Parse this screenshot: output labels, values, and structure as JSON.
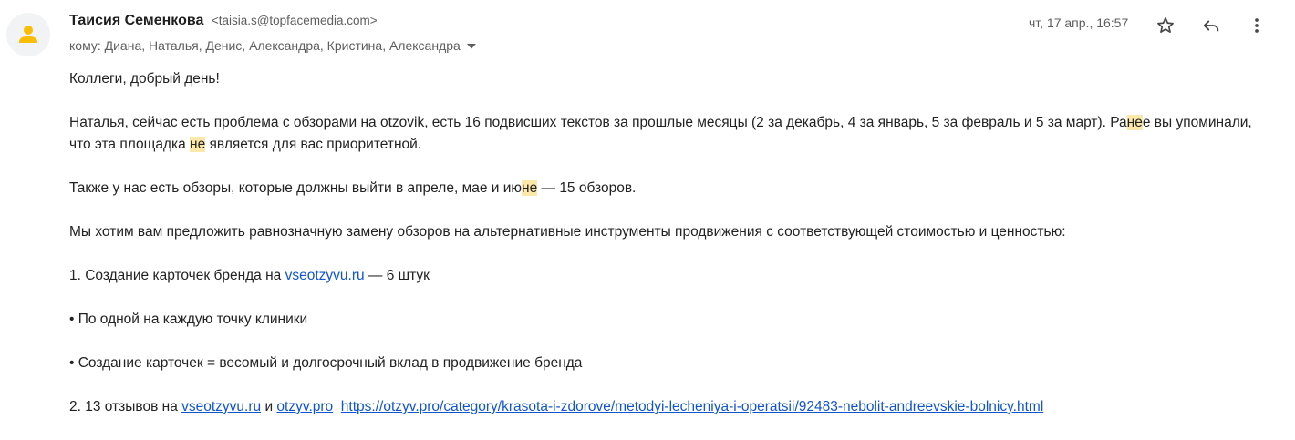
{
  "header": {
    "sender_name": "Таисия Семенкова",
    "sender_email": "<taisia.s@topfacemedia.com>",
    "recipients": "кому: Диана, Наталья, Денис, Александра, Кристина, Александра",
    "date": "чт, 17 апр., 16:57"
  },
  "icons": {
    "avatar": "person-avatar-icon",
    "recipients_toggle": "caret-down-icon",
    "star": "star-outline-icon",
    "reply": "reply-arrow-icon",
    "more": "vertical-dots-icon"
  },
  "colors": {
    "highlight": "#fce8a8",
    "link": "#1155cc"
  },
  "body": {
    "greeting": "Коллеги, добрый день!",
    "p2": {
      "a": "Наталья, сейчас есть проблема с обзорами на otzovik, есть 16 подвисших текстов за прошлые месяцы (2 за декабрь, 4 за январь, 5 за февраль и 5 за март). Ра",
      "hl1": "не",
      "b": "е вы упоминали, что эта площадка ",
      "hl2": "не",
      "c": " является для вас приоритетной."
    },
    "p3": {
      "a": "Также у нас есть обзоры, которые должны выйти в апреле, мае и ию",
      "hl": "не",
      "b": " — 15 обзоров."
    },
    "p4": "Мы хотим вам предложить равнозначную замену обзоров на альтернативные инструменты продвижения с соответствующей стоимостью и ценностью:",
    "p5": {
      "a": "1. Создание карточек бренда на ",
      "link": "vseotzyvu.ru",
      "b": " — 6 штук"
    },
    "p6": "• По одной на каждую точку клиники",
    "p7": "• Создание карточек = весомый и долгосрочный вклад в продвижение бренда",
    "p8": {
      "a": "2. 13 отзывов на ",
      "link1": "vseotzyvu.ru",
      "b": " и ",
      "link2": "otzyv.pro",
      "link3": "https://otzyv.pro/category/krasota-i-zdorove/metodyi-lecheniya-i-operatsii/92483-nebolit-andreevskie-bolnicy.html"
    }
  }
}
